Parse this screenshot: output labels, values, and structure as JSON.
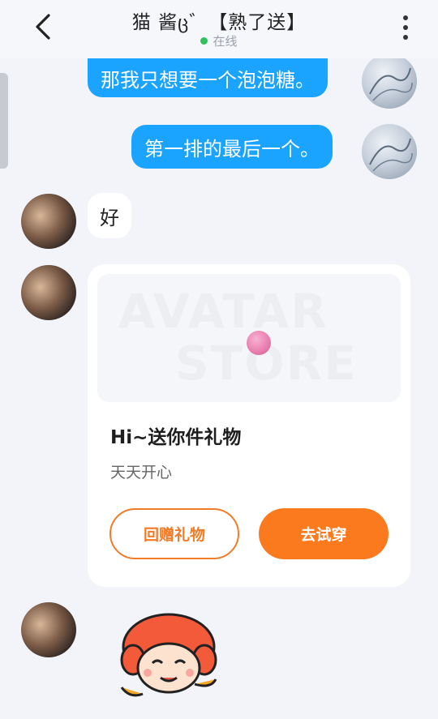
{
  "header": {
    "title": "猫  酱ც゛【熟了送】",
    "status_text": "在线"
  },
  "messages": {
    "msg1": "那我只想要一个泡泡糖。",
    "msg2": "第一排的最后一个。",
    "msg3": "好"
  },
  "gift_card": {
    "banner_word_1": "AVATAR",
    "banner_word_2": "STORE",
    "title": "Hi~送你件礼物",
    "subtitle": "天天开心",
    "return_button": "回赠礼物",
    "try_button": "去试穿"
  },
  "colors": {
    "my_bubble": "#1aa3ff",
    "online_dot": "#2fc25b",
    "accent_orange": "#fb7a1e"
  },
  "icons": {
    "back": "chevron-left-icon",
    "more": "more-vertical-icon"
  }
}
